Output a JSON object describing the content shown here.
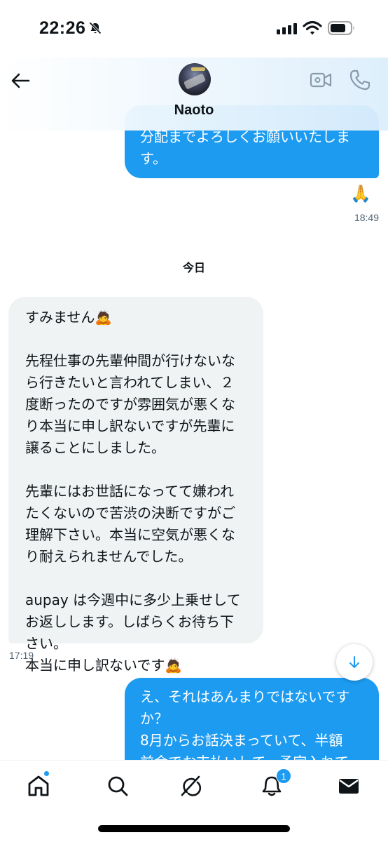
{
  "status_bar": {
    "time": "22:26"
  },
  "header": {
    "contact_name": "Naoto"
  },
  "messages": {
    "previous_outgoing": {
      "lines": [
        "分配までよろしくお願いいたしま",
        "す。"
      ]
    },
    "reaction": "🙏",
    "previous_time": "18:49",
    "date_divider": "今日",
    "incoming": {
      "lines": [
        "すみません🙇",
        "",
        "先程仕事の先輩仲間が行けないな",
        "ら行きたいと言われてしまい、２",
        "度断ったのですが雰囲気が悪くな",
        "り本当に申し訳ないですが先輩に",
        "譲ることにしました。",
        "",
        "先輩にはお世話になってて嫌われ",
        "たくないので苦渋の決断ですがご",
        "理解下さい。本当に空気が悪くな",
        "り耐えられませんでした。",
        "",
        "aupay は今週中に多少上乗せして",
        "お返しします。しばらくお待ち下",
        "さい。",
        "本当に申し訳ないです🙇"
      ],
      "time": "17:19"
    },
    "outgoing": {
      "lines": [
        "え、それはあんまりではないです",
        "か？",
        "8月からお話決まっていて、半額",
        "前金でお支払いして、予定入れて"
      ]
    }
  },
  "bottom_nav": {
    "items": [
      "home-icon",
      "search-icon",
      "grok-icon",
      "notifications-icon",
      "messages-icon"
    ],
    "notification_count": "1"
  },
  "colors": {
    "accent": "#1d9bf0",
    "incoming_bubble": "#eff3f4",
    "meta_text": "#536471"
  }
}
